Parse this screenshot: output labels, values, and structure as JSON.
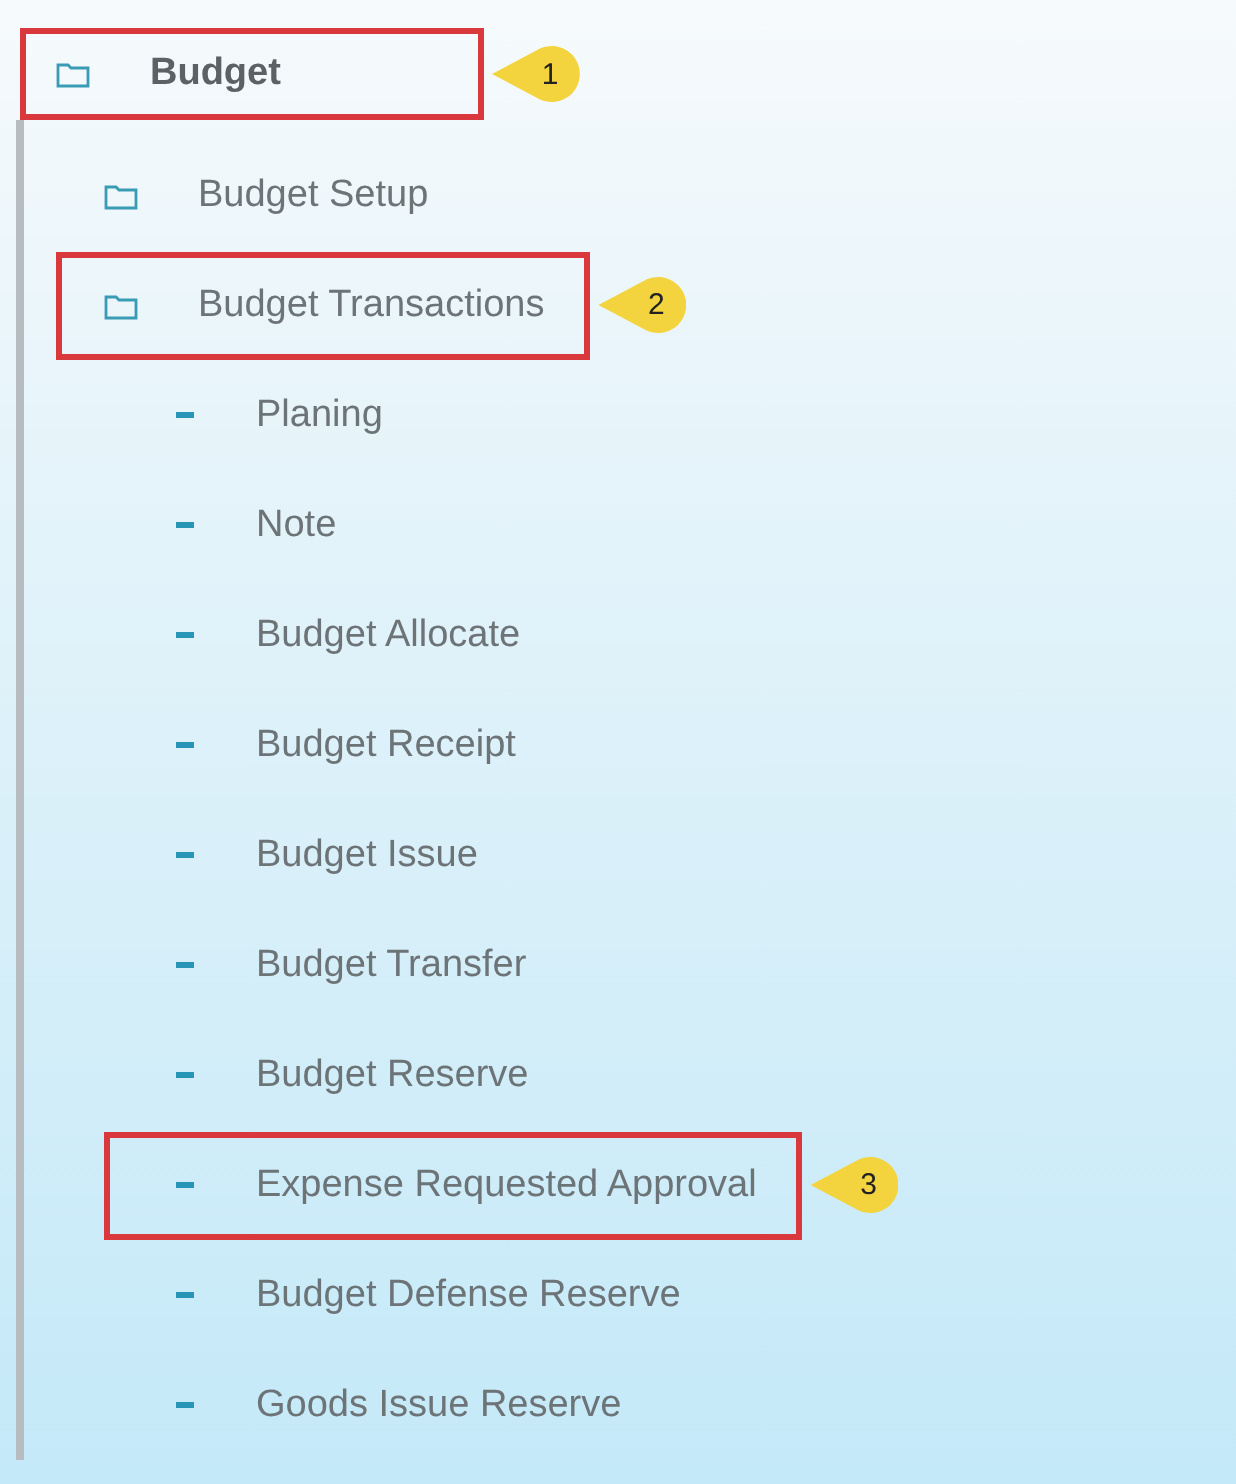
{
  "tree": [
    {
      "label": "Budget",
      "kind": "folder",
      "callout": "1",
      "children": [
        {
          "label": "Budget Setup",
          "kind": "folder"
        },
        {
          "label": "Budget Transactions",
          "kind": "folder",
          "callout": "2",
          "children": [
            {
              "label": "Planing",
              "kind": "leaf"
            },
            {
              "label": "Note",
              "kind": "leaf"
            },
            {
              "label": "Budget Allocate",
              "kind": "leaf"
            },
            {
              "label": "Budget Receipt",
              "kind": "leaf"
            },
            {
              "label": "Budget Issue",
              "kind": "leaf"
            },
            {
              "label": "Budget Transfer",
              "kind": "leaf"
            },
            {
              "label": "Budget Reserve",
              "kind": "leaf"
            },
            {
              "label": "Expense Requested Approval",
              "kind": "leaf",
              "callout": "3"
            },
            {
              "label": "Budget Defense Reserve",
              "kind": "leaf"
            },
            {
              "label": "Goods Issue Reserve",
              "kind": "leaf"
            }
          ]
        }
      ]
    }
  ]
}
